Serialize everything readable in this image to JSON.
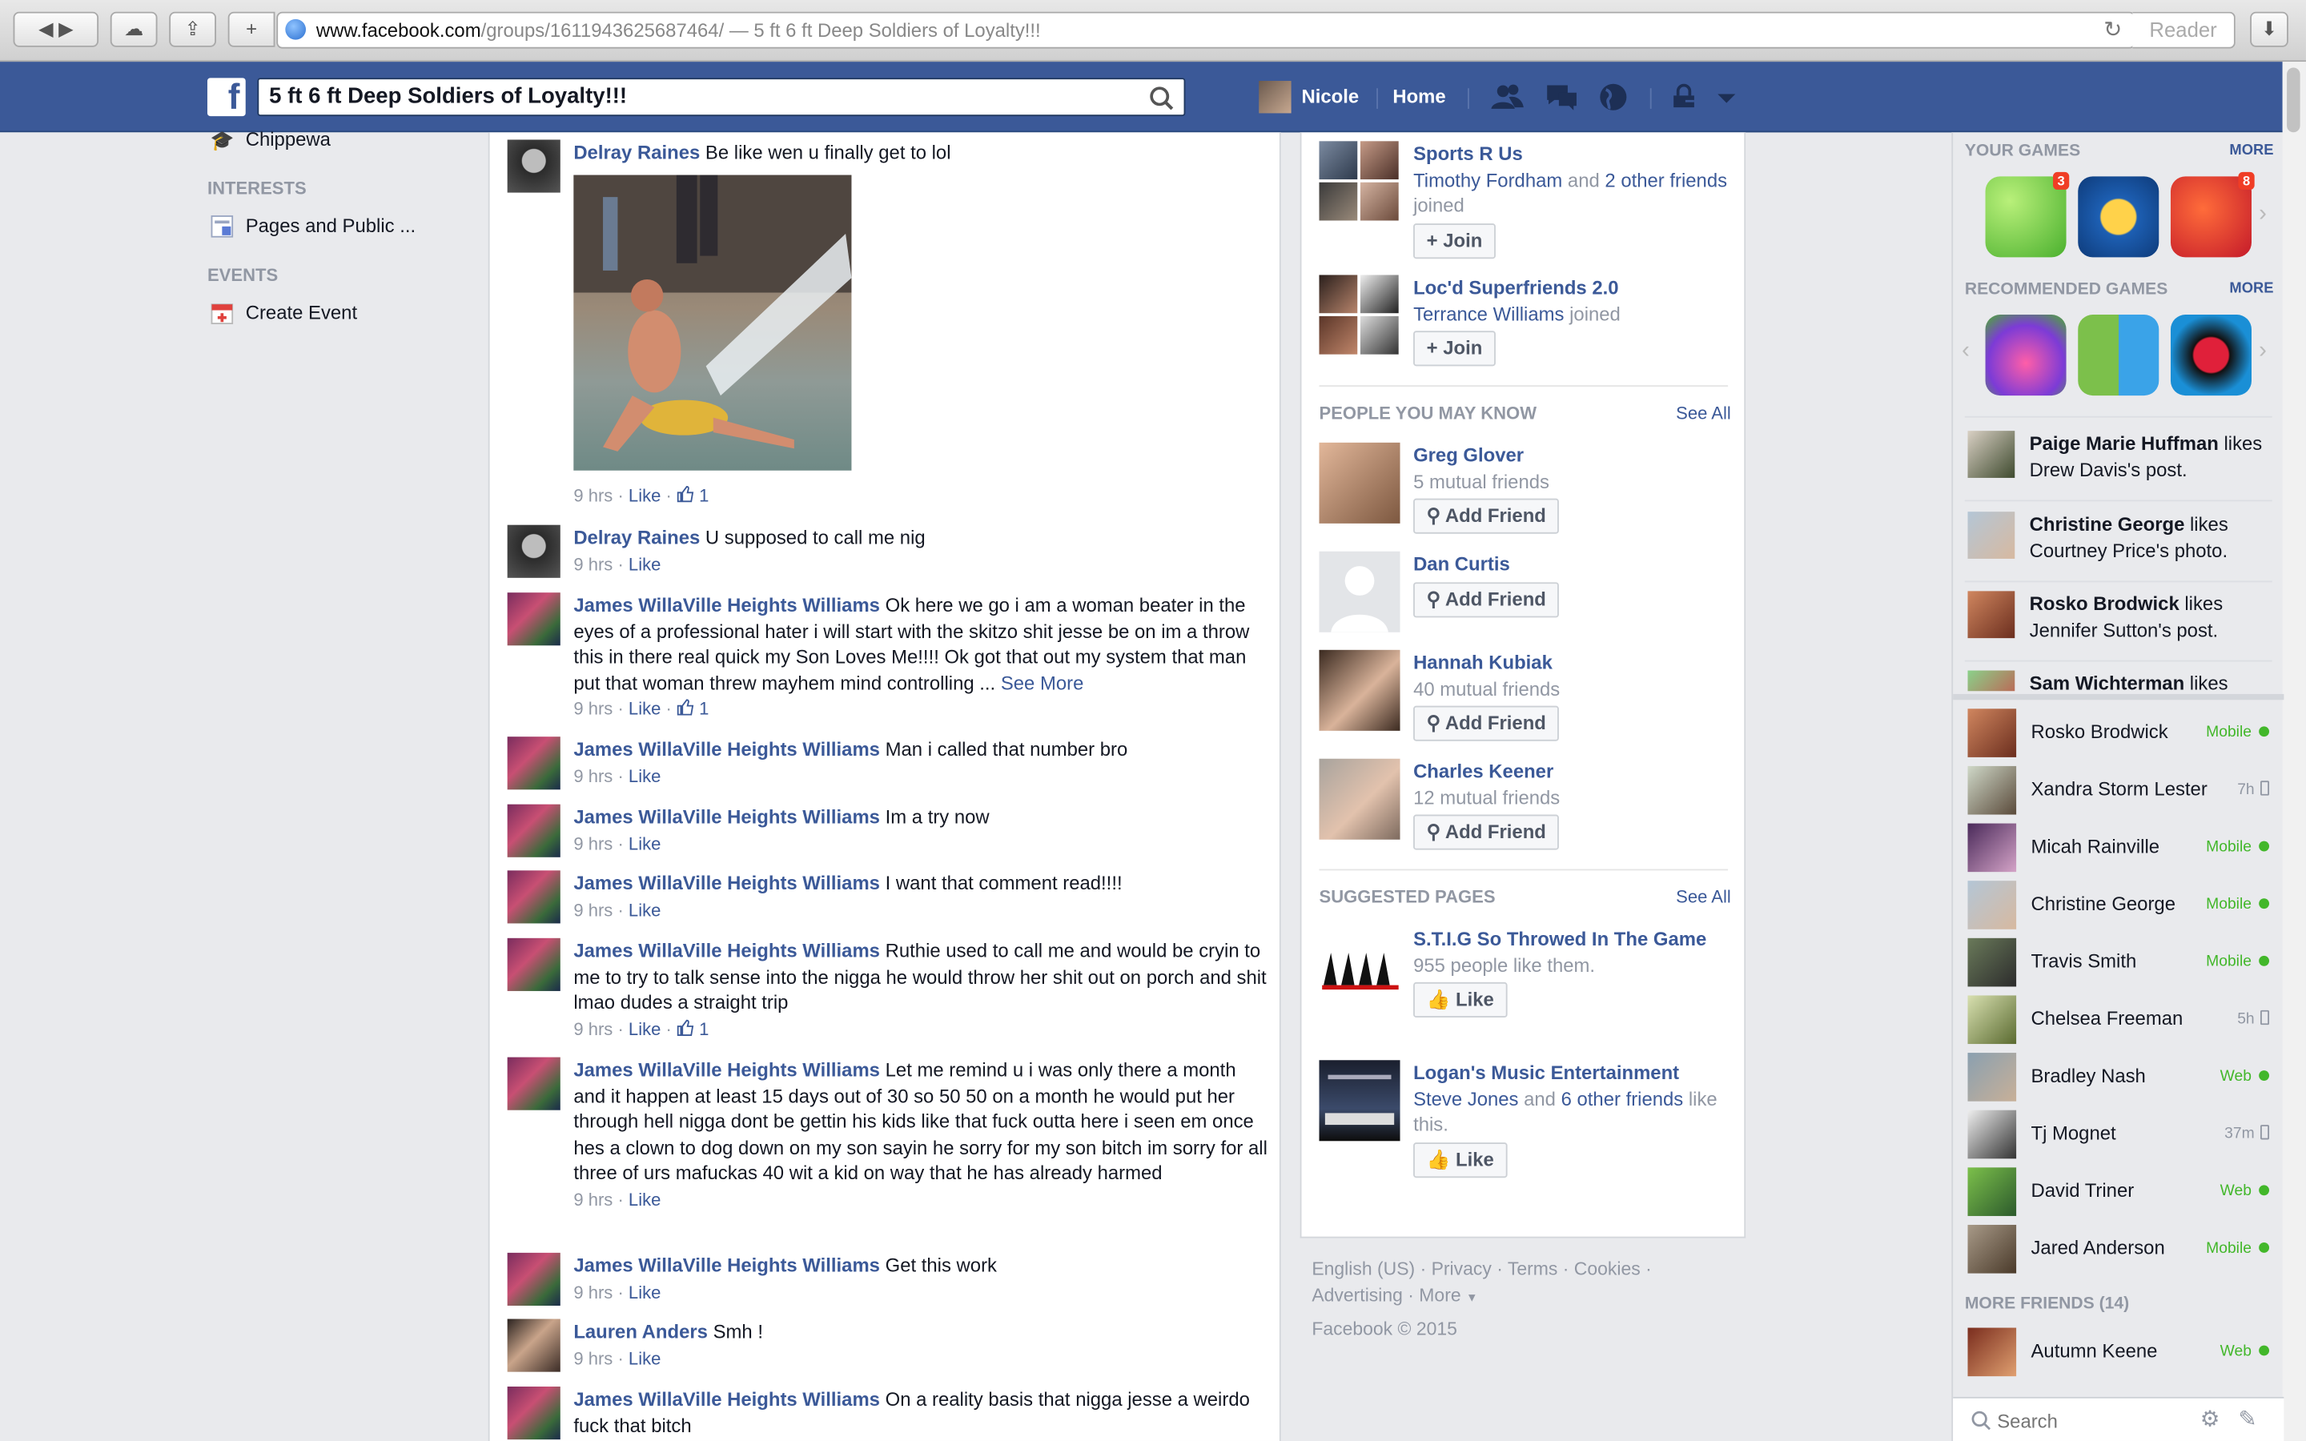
{
  "browser": {
    "url_host": "www.facebook.com",
    "url_rest": "/groups/1611943625687464/ — 5 ft 6 ft Deep Soldiers of Loyalty!!!",
    "reader_label": "Reader"
  },
  "topbar": {
    "search_value": "5 ft 6 ft Deep Soldiers of Loyalty!!!",
    "user_name": "Nicole",
    "home_label": "Home"
  },
  "leftnav": {
    "top_item": "Chippewa",
    "interests_header": "INTERESTS",
    "pages_item": "Pages and Public ...",
    "events_header": "EVENTS",
    "create_event": "Create Event"
  },
  "feed": {
    "comments": [
      {
        "author": "Delray Raines",
        "text": "Be like wen u finally get to lol",
        "time": "9 hrs",
        "like": "Like",
        "likes": "1"
      },
      {
        "author": "Delray Raines",
        "text": "U supposed to call me nig",
        "time": "9 hrs",
        "like": "Like"
      },
      {
        "author": "James WillaVille Heights Williams",
        "text": "Ok here we go i am a woman beater in the eyes of a professional hater i will start with the skitzo shit jesse be on im a throw this in there real quick my Son Loves Me!!!! Ok got that out my system that man put that woman threw mayhem mind controlling ...",
        "see_more": "See More",
        "time": "9 hrs",
        "like": "Like",
        "likes": "1"
      },
      {
        "author": "James WillaVille Heights Williams",
        "text": "Man i called that number bro",
        "time": "9 hrs",
        "like": "Like"
      },
      {
        "author": "James WillaVille Heights Williams",
        "text": "Im a try now",
        "time": "9 hrs",
        "like": "Like"
      },
      {
        "author": "James WillaVille Heights Williams",
        "text": "I want that comment read!!!!",
        "time": "9 hrs",
        "like": "Like"
      },
      {
        "author": "James WillaVille Heights Williams",
        "text": "Ruthie used to call me and would be cryin to me to try to talk sense into the nigga he would throw her shit out on porch and shit lmao dudes a straight trip",
        "time": "9 hrs",
        "like": "Like",
        "likes": "1"
      },
      {
        "author": "James WillaVille Heights Williams",
        "text": "Let me remind u i was only there a month and it happen at least 15 days out of 30 so 50 50 on a month he would put her through hell nigga dont be gettin his kids like that fuck outta here i seen em once hes a clown to dog down on my son sayin he sorry for my son bitch im sorry for all three of urs mafuckas 40 wit a kid on way that he has already harmed",
        "time": "9 hrs",
        "like": "Like"
      },
      {
        "author": "James WillaVille Heights Williams",
        "text": "Get this work",
        "time": "9 hrs",
        "like": "Like"
      },
      {
        "author": "Lauren Anders",
        "text": "Smh !",
        "time": "9 hrs",
        "like": "Like"
      },
      {
        "author": "James WillaVille Heights Williams",
        "text": "On a reality basis that nigga jesse a weirdo fuck that bitch"
      }
    ]
  },
  "groups": [
    {
      "name": "Sports R Us",
      "p1": "Timothy Fordham",
      "and": " and ",
      "p2": "2 other friends",
      "joined": " joined",
      "btn": "Join"
    },
    {
      "name": "Loc'd Superfriends 2.0",
      "p1": "Terrance Williams",
      "joined": " joined",
      "btn": "Join"
    }
  ],
  "pymk": {
    "header": "PEOPLE YOU MAY KNOW",
    "see_all": "See All",
    "people": [
      {
        "name": "Greg Glover",
        "mutual": "5 mutual friends",
        "btn": "Add Friend"
      },
      {
        "name": "Dan Curtis",
        "mutual": "",
        "btn": "Add Friend"
      },
      {
        "name": "Hannah Kubiak",
        "mutual": "40 mutual friends",
        "btn": "Add Friend"
      },
      {
        "name": "Charles Keener",
        "mutual": "12 mutual friends",
        "btn": "Add Friend"
      }
    ]
  },
  "suggested": {
    "header": "SUGGESTED PAGES",
    "see_all": "See All",
    "pages": [
      {
        "name": "S.T.I.G So Throwed In The Game",
        "sub": "955 people like them.",
        "btn": "Like"
      },
      {
        "name": "Logan's Music Entertainment",
        "p1": "Steve Jones",
        "and": " and ",
        "p2": "6 other friends",
        "sub": " like this.",
        "btn": "Like"
      }
    ]
  },
  "footer": {
    "l1": "English (US) · Privacy · Terms · Cookies ·",
    "l2": "Advertising · More",
    "copy": "Facebook © 2015"
  },
  "games": {
    "your_header": "YOUR GAMES",
    "more": "MORE",
    "badge1": "3",
    "badge2": "8",
    "rec_header": "RECOMMENDED GAMES"
  },
  "ticker": [
    {
      "name": "Paige Marie Huffman",
      "action": " likes Drew Davis's post."
    },
    {
      "name": "Christine George",
      "action": " likes Courtney Price's photo."
    },
    {
      "name": "Rosko Brodwick",
      "action": " likes Jennifer Sutton's post."
    },
    {
      "name": "Sam Wichterman",
      "action": " likes"
    }
  ],
  "chat": {
    "friends": [
      {
        "name": "Rosko Brodwick",
        "status": "Mobile"
      },
      {
        "name": "Xandra Storm Lester",
        "status": "7h"
      },
      {
        "name": "Micah Rainville",
        "status": "Mobile"
      },
      {
        "name": "Christine George",
        "status": "Mobile"
      },
      {
        "name": "Travis Smith",
        "status": "Mobile"
      },
      {
        "name": "Chelsea Freeman",
        "status": "5h"
      },
      {
        "name": "Bradley Nash",
        "status": "Web"
      },
      {
        "name": "Tj Mognet",
        "status": "37m"
      },
      {
        "name": "David Triner",
        "status": "Web"
      },
      {
        "name": "Jared Anderson",
        "status": "Mobile"
      }
    ],
    "more_header": "MORE FRIENDS (14)",
    "more_friends": [
      {
        "name": "Autumn Keene",
        "status": "Web"
      }
    ],
    "search_placeholder": "Search"
  },
  "colors": {
    "fb_blue": "#3b5998",
    "link": "#3b5998",
    "online": "#42b72a",
    "grey_text": "#9197a3"
  }
}
